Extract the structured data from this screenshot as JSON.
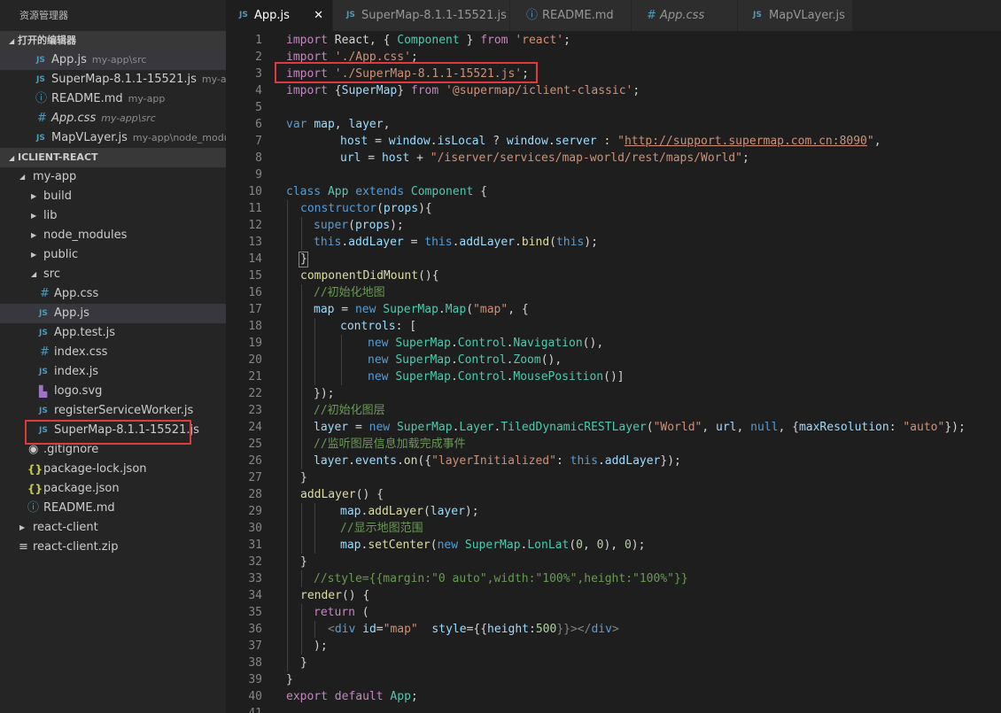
{
  "sidebar": {
    "title": "资源管理器",
    "open_editors": {
      "header": "打开的编辑器",
      "items": [
        {
          "icon": "JS",
          "label": "App.js",
          "desc": "my-app\\src"
        },
        {
          "icon": "JS",
          "label": "SuperMap-8.1.1-15521.js",
          "desc": "my-app..."
        },
        {
          "icon": "ⓘ",
          "label": "README.md",
          "desc": "my-app"
        },
        {
          "icon": "#",
          "label": "App.css",
          "desc": "my-app\\src"
        },
        {
          "icon": "JS",
          "label": "MapVLayer.js",
          "desc": "my-app\\node_modu..."
        }
      ]
    },
    "workspace": {
      "header": "ICLIENT-REACT",
      "items": [
        {
          "label": "my-app"
        },
        {
          "label": "build"
        },
        {
          "label": "lib"
        },
        {
          "label": "node_modules"
        },
        {
          "label": "public"
        },
        {
          "label": "src"
        },
        {
          "icon": "#",
          "label": "App.css"
        },
        {
          "icon": "JS",
          "label": "App.js"
        },
        {
          "icon": "JS",
          "label": "App.test.js"
        },
        {
          "icon": "#",
          "label": "index.css"
        },
        {
          "icon": "JS",
          "label": "index.js"
        },
        {
          "icon": "▙",
          "label": "logo.svg"
        },
        {
          "icon": "JS",
          "label": "registerServiceWorker.js"
        },
        {
          "icon": "JS",
          "label": "SuperMap-8.1.1-15521.js"
        },
        {
          "icon": "◉",
          "label": ".gitignore"
        },
        {
          "icon": "{}",
          "label": "package-lock.json"
        },
        {
          "icon": "{}",
          "label": "package.json"
        },
        {
          "icon": "ⓘ",
          "label": "README.md"
        },
        {
          "label": "react-client"
        },
        {
          "icon": "≡",
          "label": "react-client.zip"
        }
      ]
    }
  },
  "tabs": [
    {
      "icon": "JS",
      "label": "App.js",
      "close": "✕"
    },
    {
      "icon": "JS",
      "label": "SuperMap-8.1.1-15521.js"
    },
    {
      "icon": "ⓘ",
      "label": "README.md"
    },
    {
      "icon": "#",
      "label": "App.css"
    },
    {
      "icon": "JS",
      "label": "MapVLayer.js"
    }
  ],
  "editor": {
    "line_numbers": [
      "1",
      "2",
      "3",
      "4",
      "5",
      "6",
      "7",
      "8",
      "9",
      "10",
      "11",
      "12",
      "13",
      "14",
      "15",
      "16",
      "17",
      "18",
      "19",
      "20",
      "21",
      "22",
      "23",
      "24",
      "25",
      "26",
      "27",
      "28",
      "29",
      "30",
      "31",
      "32",
      "33",
      "34",
      "35",
      "36",
      "37",
      "38",
      "39",
      "40",
      "41"
    ],
    "code": {
      "l1": [
        "import",
        " React, { ",
        "Component",
        " } ",
        "from",
        " ",
        "'react'",
        ";"
      ],
      "l2": [
        "import",
        " ",
        "'./App.css'",
        ";"
      ],
      "l3": [
        "import",
        " ",
        "'./SuperMap-8.1.1-15521.js'",
        ";"
      ],
      "l4": [
        "import",
        " {",
        "SuperMap",
        "} ",
        "from",
        " ",
        "'@supermap/iclient-classic'",
        ";"
      ],
      "l6": [
        "var",
        " ",
        "map",
        ", ",
        "layer",
        ","
      ],
      "l7": [
        "host",
        " = ",
        "window",
        ".",
        "isLocal",
        " ? ",
        "window",
        ".",
        "server",
        " : ",
        "\"",
        "http://support.supermap.com.cn:8090",
        "\"",
        ","
      ],
      "l8": [
        "url",
        " = ",
        "host",
        " + ",
        "\"/iserver/services/map-world/rest/maps/World\"",
        ";"
      ],
      "l10": [
        "class",
        " ",
        "App",
        " ",
        "extends",
        " ",
        "Component",
        " {"
      ],
      "l11": [
        "constructor",
        "(",
        "props",
        "){"
      ],
      "l12": [
        "super",
        "(",
        "props",
        ");"
      ],
      "l13": [
        "this",
        ".",
        "addLayer",
        " = ",
        "this",
        ".",
        "addLayer",
        ".",
        "bind",
        "(",
        "this",
        ");"
      ],
      "l14": [
        "}"
      ],
      "l15": [
        "componentDidMount",
        "(){"
      ],
      "l16": [
        "//初始化地图"
      ],
      "l17": [
        "map",
        " = ",
        "new",
        " ",
        "SuperMap",
        ".",
        "Map",
        "(",
        "\"map\"",
        ", {"
      ],
      "l18": [
        "controls",
        ": ["
      ],
      "l19": [
        "new",
        " ",
        "SuperMap",
        ".",
        "Control",
        ".",
        "Navigation",
        "(),"
      ],
      "l20": [
        "new",
        " ",
        "SuperMap",
        ".",
        "Control",
        ".",
        "Zoom",
        "(),"
      ],
      "l21": [
        "new",
        " ",
        "SuperMap",
        ".",
        "Control",
        ".",
        "MousePosition",
        "()]"
      ],
      "l22": [
        "});"
      ],
      "l23": [
        "//初始化图层"
      ],
      "l24": [
        "layer",
        " = ",
        "new",
        " ",
        "SuperMap",
        ".",
        "Layer",
        ".",
        "TiledDynamicRESTLayer",
        "(",
        "\"World\"",
        ", ",
        "url",
        ", ",
        "null",
        ", {",
        "maxResolution",
        ": ",
        "\"auto\"",
        "});"
      ],
      "l25": [
        "//监听图层信息加载完成事件"
      ],
      "l26": [
        "layer",
        ".",
        "events",
        ".",
        "on",
        "({",
        "\"layerInitialized\"",
        ": ",
        "this",
        ".",
        "addLayer",
        "});"
      ],
      "l27": [
        "}"
      ],
      "l28": [
        "addLayer",
        "() {"
      ],
      "l29": [
        "map",
        ".",
        "addLayer",
        "(",
        "layer",
        ");"
      ],
      "l30": [
        "//显示地图范围"
      ],
      "l31": [
        "map",
        ".",
        "setCenter",
        "(",
        "new",
        " ",
        "SuperMap",
        ".",
        "LonLat",
        "(",
        "0",
        ", ",
        "0",
        "), ",
        "0",
        ");"
      ],
      "l32": [
        "}"
      ],
      "l33": [
        "//style={{margin:\"0 auto\",width:\"100%\",height:\"100%\"}}"
      ],
      "l34": [
        "render",
        "() {"
      ],
      "l35": [
        "return",
        " ("
      ],
      "l36": [
        "<",
        "div",
        " ",
        "id",
        "=",
        "\"map\"",
        "  ",
        "style",
        "={{",
        "height",
        ":",
        "500",
        "}}></",
        "div",
        ">"
      ],
      "l37": [
        ");"
      ],
      "l38": [
        "}"
      ],
      "l39": [
        "}"
      ],
      "l40": [
        "export",
        " ",
        "default",
        " ",
        "App",
        ";"
      ]
    }
  },
  "colors": {
    "highlight_box": "#e0393e",
    "editor_bg": "#1e1e1e",
    "sidebar_bg": "#252526"
  }
}
